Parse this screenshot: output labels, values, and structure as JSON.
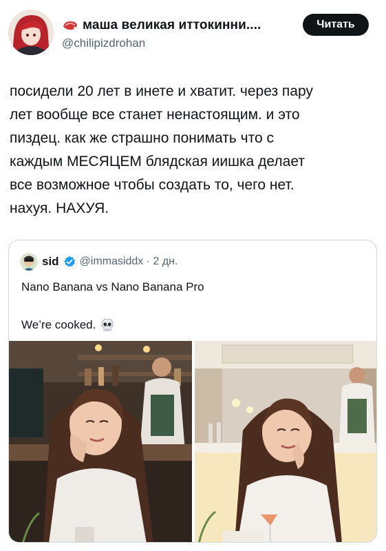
{
  "author": {
    "display_name": "маша великая иттокинни....",
    "handle": "@chilipizdrohan",
    "avatar_icon": "anime-avatar",
    "badge_icon": "steak-emoji-icon"
  },
  "follow_button": {
    "label": "Читать"
  },
  "post": {
    "lines": [
      "посидели 20 лет в инете и хватит. через пару",
      "лет вообще все станет ненастоящим. и это",
      "пиздец. как же страшно понимать что с",
      "каждым МЕСЯЦЕМ блядская иишка делает",
      "все возможное чтобы создать то, чего нет.",
      "нахуя. НАХУЯ."
    ]
  },
  "quoted": {
    "name": "sid",
    "handle_time": "@immasiddx · 2 дн.",
    "verified_icon": "verified-badge-icon",
    "line1": "Nano Banana vs Nano Banana Pro",
    "line2": "We’re cooked.",
    "emoji_icon": "skull-emoji-icon",
    "media": [
      "restaurant-photo-left",
      "restaurant-photo-right"
    ]
  },
  "colors": {
    "text": "#0f1419",
    "muted": "#536471",
    "button": "#0f1419",
    "border": "#cfd9de",
    "verified": "#1d9bf0"
  }
}
